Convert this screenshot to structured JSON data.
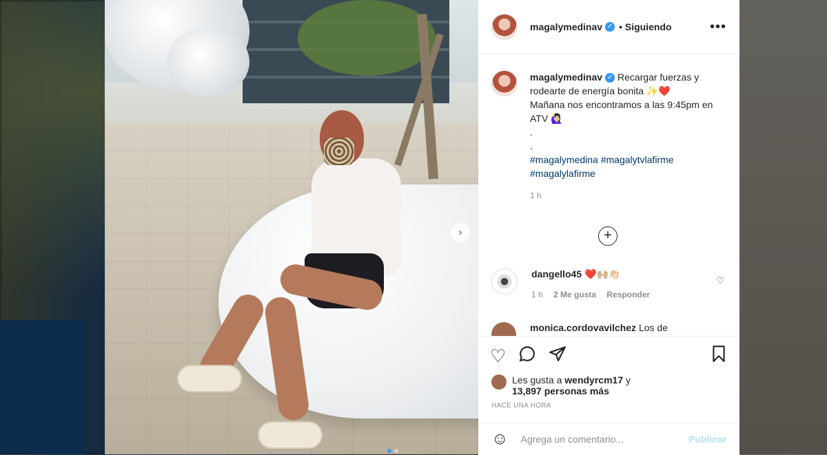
{
  "post": {
    "username": "magalymedinav",
    "following_label": "• Siguiendo",
    "more_label": "•••",
    "next_arrow": "›"
  },
  "caption": {
    "username": "magalymedinav",
    "text_line1": " Recargar fuerzas y rodearte de energía bonita ✨❤️",
    "text_line2": "Mañana nos encontramos a las 9:45pm en ATV 🙋🏻‍♀️",
    "dots": ".\n.",
    "hashtags": "#magalymedina #magalytvlafirme #magalylafirme",
    "time": "1 h"
  },
  "load_more_label": "+",
  "comments": [
    {
      "username": "dangello45",
      "text": " ❤️🙌🏼👏🏻",
      "time": "1 h",
      "likes": "2 Me gusta",
      "reply": "Responder"
    },
    {
      "username": "monica.cordovavilchez",
      "text": " Los de"
    }
  ],
  "likes": {
    "prefix": "Les gusta a ",
    "user": "wendyrcm17",
    "connector": " y",
    "count": "13,897 personas más"
  },
  "timestamp": "HACE UNA HORA",
  "add_comment": {
    "placeholder": "Agrega un comentario...",
    "publish_label": "Publicar"
  },
  "icons": {
    "like": "heart-icon",
    "comment": "comment-icon",
    "share": "share-icon",
    "save": "bookmark-icon",
    "emoji": "emoji-icon"
  }
}
